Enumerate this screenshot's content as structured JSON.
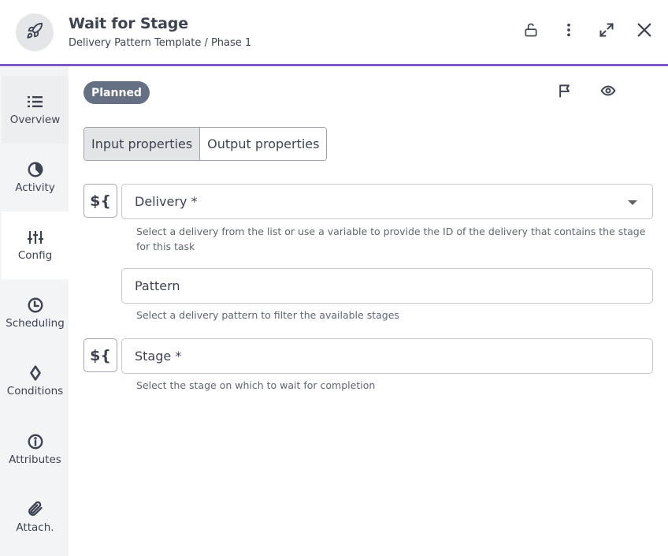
{
  "header": {
    "icon": "rocket-icon",
    "title": "Wait for Stage",
    "subtitle": "Delivery Pattern Template / Phase 1",
    "actions": [
      {
        "name": "lock-open-icon",
        "label": "Unlock"
      },
      {
        "name": "more-vertical-icon",
        "label": "More options"
      },
      {
        "name": "expand-icon",
        "label": "Expand"
      },
      {
        "name": "close-icon",
        "label": "Close"
      }
    ],
    "accent_color": "#7e57c2"
  },
  "sidebar": {
    "items": [
      {
        "label": "Overview",
        "icon": "list-icon",
        "state": "hover"
      },
      {
        "label": "Activity",
        "icon": "activity-icon",
        "state": ""
      },
      {
        "label": "Config",
        "icon": "sliders-icon",
        "state": "active"
      },
      {
        "label": "Scheduling",
        "icon": "clock-icon",
        "state": ""
      },
      {
        "label": "Conditions",
        "icon": "diamond-icon",
        "state": ""
      },
      {
        "label": "Attributes",
        "icon": "info-icon",
        "state": ""
      },
      {
        "label": "Attach.",
        "icon": "paperclip-icon",
        "state": ""
      }
    ]
  },
  "main": {
    "status_badge": "Planned",
    "status_color": "#667085",
    "top_icons": [
      {
        "name": "flag-icon"
      },
      {
        "name": "eye-icon"
      }
    ],
    "tabs": [
      {
        "label": "Input properties",
        "selected": true
      },
      {
        "label": "Output properties",
        "selected": false
      }
    ],
    "variable_button_label": "${",
    "fields": [
      {
        "label": "Delivery *",
        "type": "select",
        "has_variable_toggle": true,
        "helper": "Select a delivery from the list or use a variable to provide the ID of the delivery that contains the stage for this task"
      },
      {
        "label": "Pattern",
        "type": "select",
        "has_variable_toggle": false,
        "helper": "Select a delivery pattern to filter the available stages"
      },
      {
        "label": "Stage *",
        "type": "select",
        "has_variable_toggle": true,
        "helper": "Select the stage on which to wait for completion"
      }
    ]
  }
}
